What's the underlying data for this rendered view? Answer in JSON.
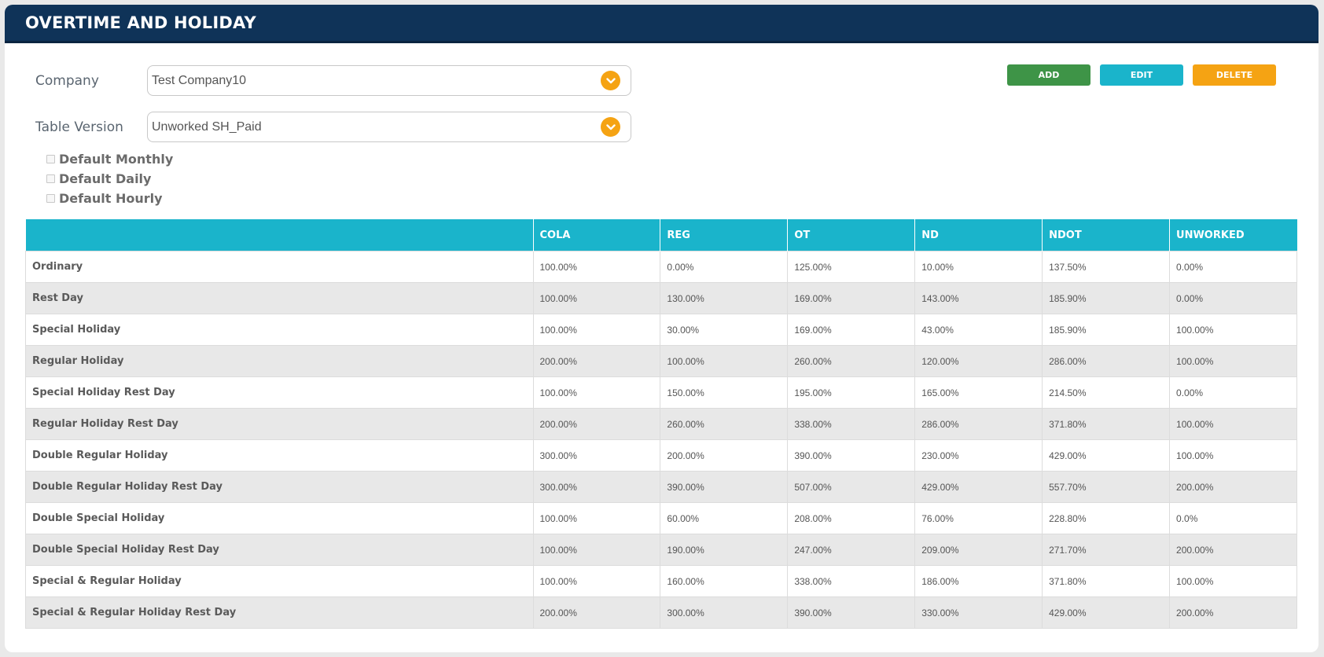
{
  "header": {
    "title": "OVERTIME AND HOLIDAY"
  },
  "form": {
    "company": {
      "label": "Company",
      "value": "Test Company10"
    },
    "table_version": {
      "label": "Table Version",
      "value": "Unworked SH_Paid"
    },
    "checkboxes": [
      {
        "label": "Default Monthly",
        "checked": false
      },
      {
        "label": "Default Daily",
        "checked": false
      },
      {
        "label": "Default Hourly",
        "checked": false
      }
    ]
  },
  "buttons": {
    "add": "ADD",
    "edit": "EDIT",
    "delete": "DELETE"
  },
  "colors": {
    "header_bg": "#0f3358",
    "table_header_bg": "#1ab4cb",
    "add": "#3e9447",
    "edit": "#1ab4cb",
    "delete": "#f5a313",
    "chevron": "#f5a313"
  },
  "icons": {
    "dropdown": "chevron-down-icon"
  },
  "table": {
    "columns": [
      "",
      "COLA",
      "REG",
      "OT",
      "ND",
      "NDOT",
      "UNWORKED"
    ],
    "rows": [
      [
        "Ordinary",
        "100.00%",
        "0.00%",
        "125.00%",
        "10.00%",
        "137.50%",
        "0.00%"
      ],
      [
        "Rest Day",
        "100.00%",
        "130.00%",
        "169.00%",
        "143.00%",
        "185.90%",
        "0.00%"
      ],
      [
        "Special Holiday",
        "100.00%",
        "30.00%",
        "169.00%",
        "43.00%",
        "185.90%",
        "100.00%"
      ],
      [
        "Regular Holiday",
        "200.00%",
        "100.00%",
        "260.00%",
        "120.00%",
        "286.00%",
        "100.00%"
      ],
      [
        "Special Holiday Rest Day",
        "100.00%",
        "150.00%",
        "195.00%",
        "165.00%",
        "214.50%",
        "0.00%"
      ],
      [
        "Regular Holiday Rest Day",
        "200.00%",
        "260.00%",
        "338.00%",
        "286.00%",
        "371.80%",
        "100.00%"
      ],
      [
        "Double Regular Holiday",
        "300.00%",
        "200.00%",
        "390.00%",
        "230.00%",
        "429.00%",
        "100.00%"
      ],
      [
        "Double Regular Holiday Rest Day",
        "300.00%",
        "390.00%",
        "507.00%",
        "429.00%",
        "557.70%",
        "200.00%"
      ],
      [
        "Double Special Holiday",
        "100.00%",
        "60.00%",
        "208.00%",
        "76.00%",
        "228.80%",
        "0.0%"
      ],
      [
        "Double Special Holiday Rest Day",
        "100.00%",
        "190.00%",
        "247.00%",
        "209.00%",
        "271.70%",
        "200.00%"
      ],
      [
        "Special & Regular Holiday",
        "100.00%",
        "160.00%",
        "338.00%",
        "186.00%",
        "371.80%",
        "100.00%"
      ],
      [
        "Special & Regular Holiday Rest Day",
        "200.00%",
        "300.00%",
        "390.00%",
        "330.00%",
        "429.00%",
        "200.00%"
      ]
    ]
  }
}
